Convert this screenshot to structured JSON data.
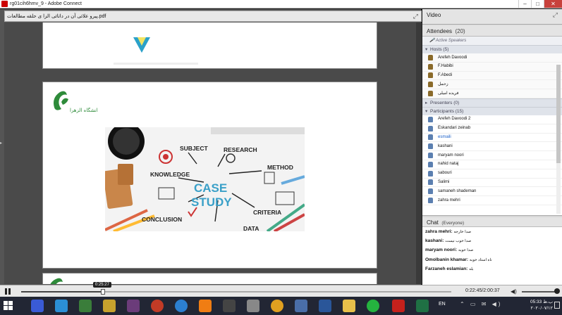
{
  "window": {
    "title": "rg01cih6hmv_9 - Adobe Connect",
    "controls": [
      "–",
      "□",
      "✕"
    ]
  },
  "share_pod": {
    "document_name": "پیرو علائی آن در داتائی الزا ی حلقه مطالعات.pdf",
    "expand_icon": "expand-icon"
  },
  "video_pod": {
    "title": "Video"
  },
  "attendees": {
    "title": "Attendees",
    "count": "(20)",
    "active_speakers": "Active Speakers",
    "hosts_label": "Hosts (5)",
    "hosts": [
      "Arefeh Davoodi",
      "F.Habibi",
      "F.Abedi",
      "زحمل",
      "فریده امیلی"
    ],
    "presenters_label": "Presenters (0)",
    "participants_label": "Participants (15)",
    "participants": [
      "Arefeh Davoodi 2",
      "Eskandari zeinab",
      "esmaili",
      "kashani",
      "maryam noori",
      "nahid nataj",
      "sabouri",
      "Salimi",
      "samaneh shademan",
      "zahra mehri"
    ]
  },
  "chat": {
    "title": "Chat",
    "scope": "(Everyone)",
    "messages": [
      {
        "who": "zahra mehri:",
        "msg": "صدا خارجه"
      },
      {
        "who": "kashani:",
        "msg": "صدا خوب نیست"
      },
      {
        "who": "maryam noori:",
        "msg": "صدا خوبه"
      },
      {
        "who": "Omolbanin khamar:",
        "msg": "ناه استاد خوبه"
      },
      {
        "who": "Farzaneh eslamian:",
        "msg": "بله"
      }
    ]
  },
  "playback": {
    "tooltip": "0:25:27",
    "time": "0:22:45/2:00:37",
    "progress": 0.19
  },
  "slide": {
    "words": [
      "SUBJECT",
      "RESEARCH",
      "KNOWLEDGE",
      "METHOD",
      "CASE",
      "STUDY",
      "CONCLUSION",
      "CRITERIA",
      "DATA"
    ]
  },
  "taskbar": {
    "lang": "EN",
    "clock_time": "05:33 ب.ظ",
    "clock_date": "۲۰۲۰/۰۷/۱۲"
  },
  "colors": {
    "accent_green": "#2e8b3a",
    "link_blue": "#1a5fc8"
  }
}
